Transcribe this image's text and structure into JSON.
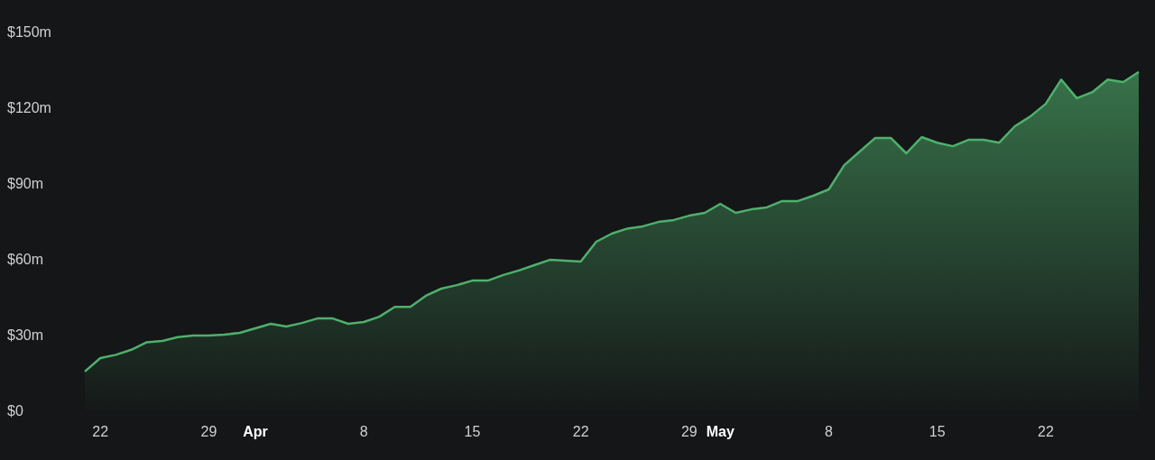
{
  "chart": {
    "chart_data": {
      "type": "area",
      "categories": [
        null,
        "22",
        null,
        null,
        null,
        null,
        null,
        null,
        "29",
        null,
        null,
        "Apr",
        null,
        null,
        null,
        null,
        null,
        null,
        "8",
        null,
        null,
        null,
        null,
        null,
        null,
        "15",
        null,
        null,
        null,
        null,
        null,
        null,
        "22",
        null,
        null,
        null,
        null,
        null,
        null,
        "29",
        null,
        "May",
        null,
        null,
        null,
        null,
        null,
        null,
        "8",
        null,
        null,
        null,
        null,
        null,
        null,
        "15",
        null,
        null,
        null,
        null,
        null,
        null,
        "22",
        null,
        null,
        null,
        null,
        null,
        null
      ],
      "series": [
        {
          "color": "#4fb06c",
          "values": [
            15.4,
            20.7,
            22,
            24,
            27,
            27.5,
            29,
            29.6,
            29.6,
            30,
            30.7,
            32.5,
            34.3,
            33.2,
            34.6,
            36.4,
            36.4,
            34.3,
            35,
            37.1,
            41,
            41,
            45.4,
            48.2,
            49.6,
            51.4,
            51.4,
            53.6,
            55.4,
            57.5,
            59.6,
            59.3,
            58.9,
            66.8,
            70,
            72,
            72.9,
            74.6,
            75.4,
            77.1,
            78.2,
            81.8,
            78.2,
            79.6,
            80.4,
            82.9,
            82.9,
            85,
            87.5,
            97.1,
            102.5,
            107.9,
            107.9,
            101.8,
            108.2,
            106,
            104.6,
            107.1,
            107.1,
            106,
            112.5,
            116.4,
            121.4,
            131,
            123.6,
            126,
            131,
            130,
            134
          ]
        }
      ],
      "ylim": [
        0,
        150
      ],
      "yticks": [
        {
          "value": 0,
          "label": "$0"
        },
        {
          "value": 30,
          "label": "$30m"
        },
        {
          "value": 60,
          "label": "$60m"
        },
        {
          "value": 90,
          "label": "$90m"
        },
        {
          "value": 120,
          "label": "$120m"
        },
        {
          "value": 150,
          "label": "$150m"
        }
      ]
    }
  }
}
